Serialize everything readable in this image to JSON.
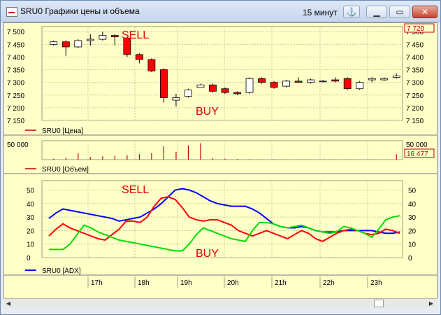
{
  "window": {
    "title": "SRU0 Графики цены и объема",
    "interval": "15 минут",
    "pin_icon": "anchor-icon",
    "minimize_icon": "minimize-icon",
    "maximize_icon": "maximize-icon",
    "close_icon": "close-icon"
  },
  "price_panel": {
    "legend": "SRU0 [Цена]",
    "yticks": [
      "7 500",
      "7 450",
      "7 400",
      "7 350",
      "7 300",
      "7 250",
      "7 200",
      "7 150"
    ],
    "current": "7 720",
    "sell_label": "SELL",
    "buy_label": "BUY",
    "up_color": "#ffffff",
    "down_color": "#ff0000"
  },
  "volume_panel": {
    "legend": "SRU0 [Объем]",
    "ytick": "50 000",
    "current": "16 477"
  },
  "adx_panel": {
    "legend": "SRU0 [ADX]",
    "yticks": [
      "50",
      "40",
      "30",
      "20",
      "10",
      "0"
    ],
    "sell_label": "SELL",
    "buy_label": "BUY",
    "adx_color": "#0000ff",
    "plus_color": "#ff0000",
    "minus_color": "#00dd00"
  },
  "time_axis": [
    "17h",
    "18h",
    "19h",
    "20h",
    "21h",
    "22h",
    "23h"
  ],
  "chart_data": [
    {
      "type": "candlestick",
      "title": "SRU0 [Цена]",
      "ylim": [
        7150,
        7520
      ],
      "candles": [
        [
          7450,
          7460,
          7445,
          7465
        ],
        [
          7460,
          7440,
          7405,
          7465
        ],
        [
          7440,
          7465,
          7435,
          7470
        ],
        [
          7465,
          7470,
          7445,
          7490
        ],
        [
          7470,
          7485,
          7465,
          7500
        ],
        [
          7485,
          7480,
          7445,
          7490
        ],
        [
          7475,
          7410,
          7400,
          7480
        ],
        [
          7410,
          7390,
          7375,
          7415
        ],
        [
          7390,
          7345,
          7340,
          7395
        ],
        [
          7350,
          7240,
          7220,
          7355
        ],
        [
          7230,
          7240,
          7205,
          7255
        ],
        [
          7245,
          7270,
          7240,
          7275
        ],
        [
          7280,
          7290,
          7280,
          7295
        ],
        [
          7290,
          7265,
          7260,
          7295
        ],
        [
          7275,
          7260,
          7255,
          7280
        ],
        [
          7260,
          7255,
          7250,
          7265
        ],
        [
          7260,
          7315,
          7255,
          7320
        ],
        [
          7315,
          7300,
          7295,
          7320
        ],
        [
          7300,
          7280,
          7275,
          7305
        ],
        [
          7285,
          7305,
          7280,
          7310
        ],
        [
          7305,
          7300,
          7300,
          7320
        ],
        [
          7300,
          7310,
          7295,
          7315
        ],
        [
          7305,
          7305,
          7300,
          7310
        ],
        [
          7310,
          7305,
          7300,
          7320
        ],
        [
          7315,
          7275,
          7270,
          7320
        ],
        [
          7275,
          7300,
          7270,
          7305
        ],
        [
          7310,
          7315,
          7300,
          7320
        ],
        [
          7310,
          7315,
          7305,
          7320
        ],
        [
          7320,
          7325,
          7315,
          7335
        ]
      ]
    },
    {
      "type": "bar",
      "title": "SRU0 [Объем]",
      "ylim": [
        0,
        60000
      ],
      "values": [
        3000,
        6000,
        20000,
        8000,
        10000,
        12000,
        14000,
        17000,
        20000,
        42000,
        25000,
        45000,
        52000,
        4000,
        3000,
        2000,
        1500,
        1000,
        1200,
        900,
        800,
        700,
        900,
        1000,
        800,
        700,
        800,
        700,
        16477
      ]
    },
    {
      "type": "line",
      "title": "SRU0 [ADX]",
      "ylim": [
        0,
        57
      ],
      "x": [
        0,
        1,
        2,
        3,
        4,
        5,
        6,
        7,
        8,
        9,
        10,
        11,
        12,
        13,
        14,
        15,
        16,
        17,
        18,
        19,
        20,
        21,
        22,
        23,
        24,
        25,
        26,
        27,
        28,
        29,
        30,
        31,
        32,
        33,
        34,
        35,
        36,
        37,
        38,
        39,
        40,
        41,
        42,
        43,
        44,
        45,
        46,
        47,
        48,
        49,
        50
      ],
      "series": [
        {
          "name": "SRU0 [ADX]",
          "values": [
            29,
            33,
            36,
            35,
            34,
            33,
            32,
            31,
            30,
            29,
            27,
            28,
            29,
            30,
            33,
            36,
            40,
            45,
            50,
            51,
            50,
            48,
            45,
            42,
            40,
            39,
            38,
            38,
            38,
            36,
            33,
            29,
            25,
            23,
            22,
            22,
            23,
            22,
            20,
            19,
            19,
            19,
            20,
            20,
            20,
            20,
            20,
            19,
            18,
            18,
            19
          ]
        },
        {
          "name": "+DI",
          "values": [
            16,
            21,
            25,
            22,
            20,
            18,
            16,
            14,
            13,
            17,
            21,
            27,
            27,
            26,
            30,
            38,
            44,
            45,
            43,
            37,
            30,
            28,
            27,
            28,
            28,
            26,
            24,
            20,
            18,
            16,
            18,
            20,
            18,
            16,
            14,
            17,
            20,
            18,
            14,
            12,
            15,
            18,
            20,
            21,
            20,
            18,
            17,
            18,
            21,
            20,
            18
          ]
        },
        {
          "name": "-DI",
          "values": [
            6,
            6,
            6,
            10,
            17,
            24,
            22,
            19,
            17,
            15,
            13,
            12,
            11,
            10,
            9,
            8,
            7,
            6,
            5,
            5,
            10,
            17,
            22,
            20,
            18,
            16,
            14,
            13,
            12,
            20,
            26,
            26,
            25,
            23,
            22,
            23,
            24,
            22,
            20,
            19,
            18,
            19,
            23,
            22,
            20,
            18,
            15,
            21,
            28,
            30,
            31
          ]
        }
      ]
    }
  ]
}
